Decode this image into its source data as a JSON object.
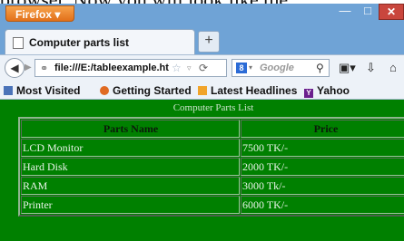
{
  "caption_text": "browser. Now you will look like the",
  "window": {
    "firefox_label": "Firefox",
    "tab_title": "Computer parts list",
    "newtab_symbol": "+",
    "url": "file:///E:/tableexample.html",
    "search_placeholder": "Google",
    "bookmarks": [
      {
        "label": "Most Visited",
        "icon": "most-visited-icon"
      },
      {
        "label": "Getting Started",
        "icon": "getting-started-icon"
      },
      {
        "label": "Latest Headlines",
        "icon": "rss-icon"
      },
      {
        "label": "Yahoo",
        "icon": "yahoo-icon"
      }
    ]
  },
  "table": {
    "caption": "Computer Parts List",
    "headers": [
      "Parts Name",
      "Price"
    ],
    "rows": [
      [
        "LCD Monitor",
        "7500 TK/-"
      ],
      [
        "Hard Disk",
        "2000 TK/-"
      ],
      [
        "RAM",
        "3000 Tk/-"
      ],
      [
        "Printer",
        "6000 TK/-"
      ]
    ]
  },
  "colors": {
    "page_background": "#008000",
    "firefox_button": "#e2701a"
  }
}
